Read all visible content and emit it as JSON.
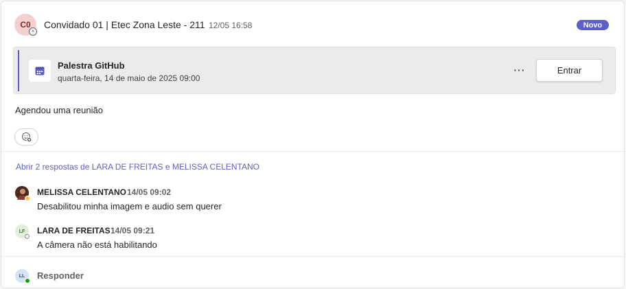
{
  "post": {
    "avatar_initials": "C0",
    "author": "Convidado 01 | Etec Zona Leste - 211",
    "timestamp": "12/05 16:58",
    "badge": "Novo",
    "message": "Agendou uma reunião"
  },
  "meeting": {
    "title": "Palestra GitHub",
    "datetime": "quarta-feira, 14 de maio de 2025 09:00",
    "more_label": "···",
    "join_label": "Entrar",
    "icon": "calendar-icon"
  },
  "thread": {
    "replies_link": "Abrir 2 respostas de LARA DE FREITAS e MELISSA CELENTANO",
    "replies": [
      {
        "author": "MELISSA CELENTANO",
        "time": "14/05 09:02",
        "text": "Desabilitou minha imagem e audio sem querer",
        "avatar_initials": "",
        "presence": "away"
      },
      {
        "author": "LARA DE FREITAS",
        "time": "14/05 09:21",
        "text": "A câmera não está habilitando",
        "avatar_initials": "LF",
        "presence": "offline"
      }
    ]
  },
  "footer": {
    "avatar_initials": "LL",
    "reply_label": "Responder"
  },
  "colors": {
    "accent": "#5b5fc7",
    "away": "#f8c044",
    "available": "#13a10e"
  }
}
